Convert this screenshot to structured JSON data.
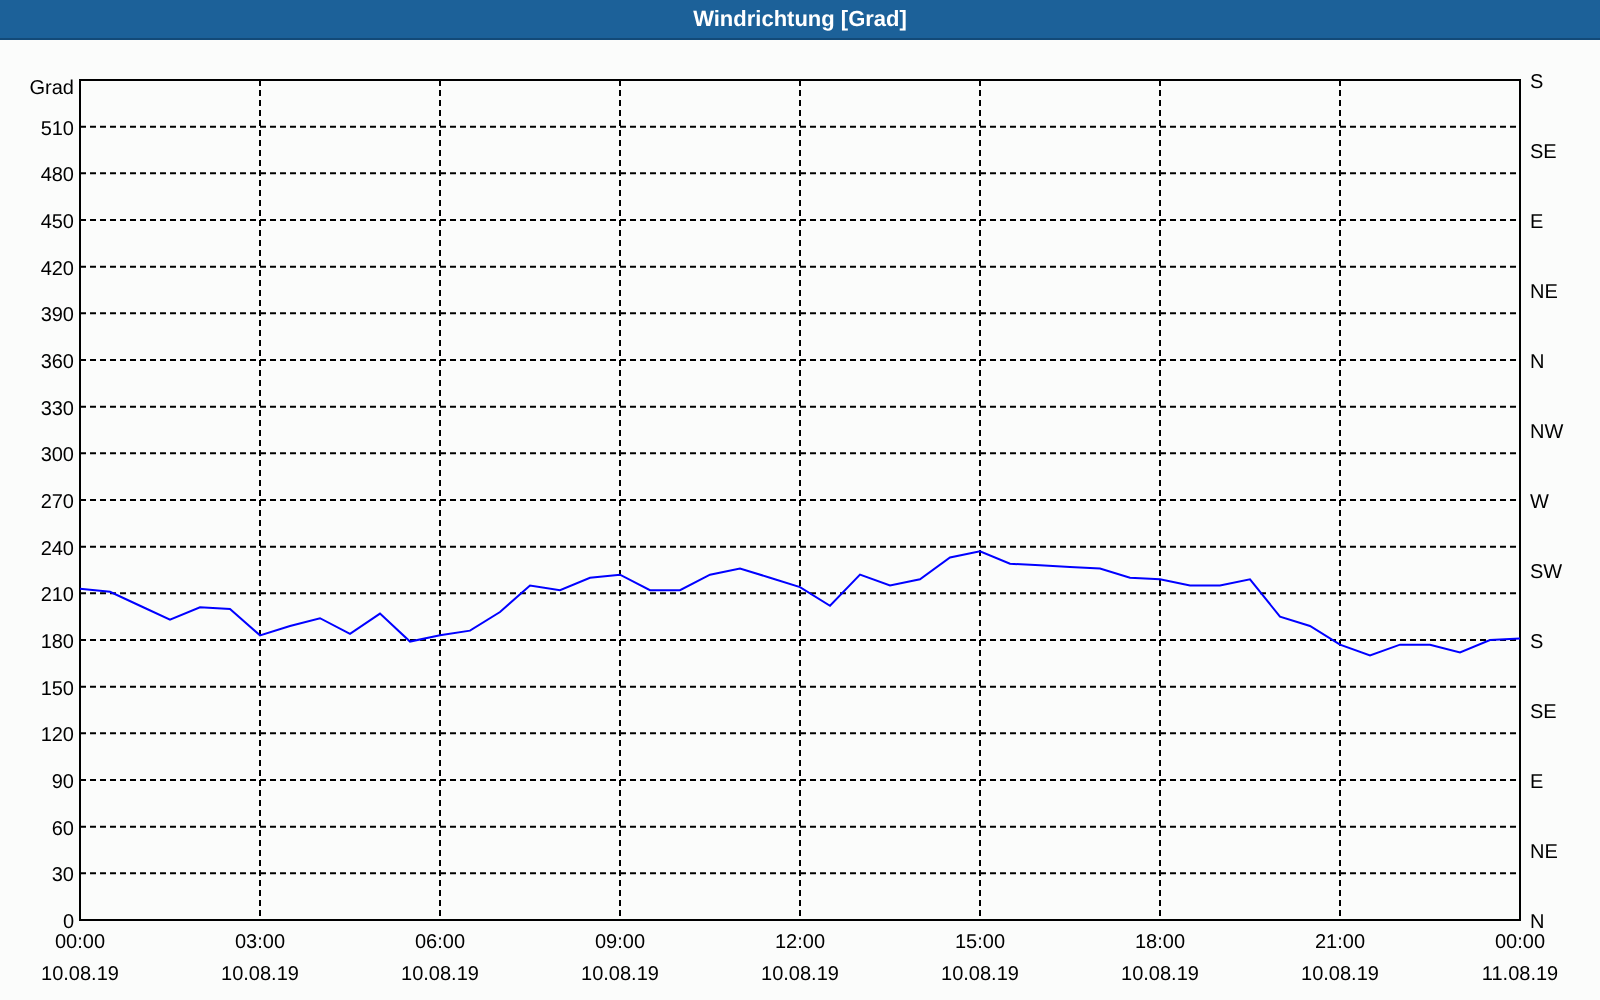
{
  "window": {
    "title": "Windrichtung [Grad]"
  },
  "chart": {
    "chart_data": {
      "type": "line",
      "ylabel": "Grad",
      "x": [
        0,
        0.5,
        1,
        1.5,
        2,
        2.5,
        3,
        3.5,
        4,
        4.5,
        5,
        5.5,
        6,
        6.5,
        7,
        7.5,
        8,
        8.5,
        9,
        9.5,
        10,
        10.5,
        11,
        11.5,
        12,
        12.5,
        13,
        13.5,
        14,
        14.5,
        15,
        15.5,
        16,
        16.5,
        17,
        17.5,
        18,
        18.5,
        19,
        19.5,
        20,
        20.5,
        21,
        21.5,
        22,
        22.5,
        23,
        23.5,
        24
      ],
      "grid": true,
      "series": [
        {
          "color": "#0000ff",
          "values": [
            213,
            211,
            202,
            193,
            201,
            200,
            183,
            189,
            194,
            184,
            197,
            179,
            183,
            186,
            198,
            215,
            212,
            220,
            222,
            212,
            212,
            222,
            226,
            220,
            214,
            202,
            222,
            215,
            219,
            233,
            237,
            229,
            228,
            227,
            226,
            220,
            219,
            215,
            215,
            219,
            195,
            189,
            177,
            170,
            177,
            177,
            172,
            180,
            181
          ]
        }
      ],
      "xlim": [
        0,
        24
      ],
      "ylim": [
        0,
        540
      ],
      "xticks": [
        {
          "value": 0,
          "label": "00:00"
        },
        {
          "value": 3,
          "label": "03:00"
        },
        {
          "value": 6,
          "label": "06:00"
        },
        {
          "value": 9,
          "label": "09:00"
        },
        {
          "value": 12,
          "label": "12:00"
        },
        {
          "value": 15,
          "label": "15:00"
        },
        {
          "value": 18,
          "label": "18:00"
        },
        {
          "value": 21,
          "label": "21:00"
        },
        {
          "value": 24,
          "label": "00:00"
        }
      ],
      "yticks": [
        0,
        30,
        60,
        90,
        120,
        150,
        180,
        210,
        240,
        270,
        300,
        330,
        360,
        390,
        420,
        450,
        480,
        510
      ]
    },
    "x_date_labels": [
      "10.08.19",
      "10.08.19",
      "10.08.19",
      "10.08.19",
      "10.08.19",
      "10.08.19",
      "10.08.19",
      "10.08.19",
      "11.08.19"
    ],
    "right_axis_labels": [
      "S",
      "SE",
      "E",
      "NE",
      "N",
      "NW",
      "W",
      "SW",
      "S",
      "SE",
      "E",
      "NE",
      "N"
    ]
  }
}
